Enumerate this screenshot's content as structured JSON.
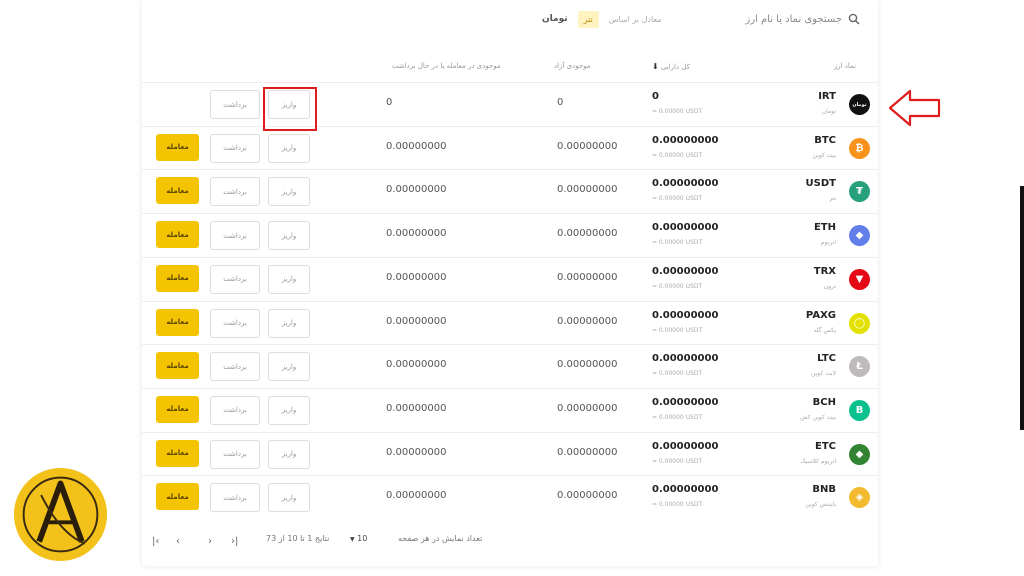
{
  "search": {
    "placeholder": "جستجوی نماد یا نام ارز"
  },
  "toggle": {
    "hint": "معادل بر اساس",
    "active": "تتر",
    "other": "تومان"
  },
  "table": {
    "headers": {
      "asset": "نماد ارز",
      "total": "کل دارایی",
      "available": "موجودی آزاد",
      "in_order": "موجودی در معامله یا در حال برداشت"
    },
    "rows": [
      {
        "symbol": "IRT",
        "name": "تومان",
        "balance": "0",
        "usdt": "≈ 0.00000 USDT",
        "available": "0",
        "in_order": "0",
        "icon": "toman-icon",
        "color": "#111111",
        "glyph": "تومان",
        "trade": false
      },
      {
        "symbol": "BTC",
        "name": "بیت کوین",
        "balance": "0.00000000",
        "usdt": "≈ 0.00000 USDT",
        "available": "0.00000000",
        "in_order": "0.00000000",
        "icon": "bitcoin-icon",
        "color": "#f7931a",
        "glyph": "₿",
        "trade": true
      },
      {
        "symbol": "USDT",
        "name": "تتر",
        "balance": "0.00000000",
        "usdt": "≈ 0.00000 USDT",
        "available": "0.00000000",
        "in_order": "0.00000000",
        "icon": "tether-icon",
        "color": "#26a17b",
        "glyph": "₮",
        "trade": true
      },
      {
        "symbol": "ETH",
        "name": "اتریوم",
        "balance": "0.00000000",
        "usdt": "≈ 0.00000 USDT",
        "available": "0.00000000",
        "in_order": "0.00000000",
        "icon": "ethereum-icon",
        "color": "#627eea",
        "glyph": "◆",
        "trade": true
      },
      {
        "symbol": "TRX",
        "name": "ترون",
        "balance": "0.00000000",
        "usdt": "≈ 0.00000 USDT",
        "available": "0.00000000",
        "in_order": "0.00000000",
        "icon": "tron-icon",
        "color": "#e50915",
        "glyph": "▼",
        "trade": true
      },
      {
        "symbol": "PAXG",
        "name": "پکس گلد",
        "balance": "0.00000000",
        "usdt": "≈ 0.00000 USDT",
        "available": "0.00000000",
        "in_order": "0.00000000",
        "icon": "paxgold-icon",
        "color": "#e4e100",
        "glyph": "◯",
        "trade": true
      },
      {
        "symbol": "LTC",
        "name": "لایت کوین",
        "balance": "0.00000000",
        "usdt": "≈ 0.00000 USDT",
        "available": "0.00000000",
        "in_order": "0.00000000",
        "icon": "litecoin-icon",
        "color": "#bfbbbb",
        "glyph": "Ł",
        "trade": true
      },
      {
        "symbol": "BCH",
        "name": "بیت کوین کش",
        "balance": "0.00000000",
        "usdt": "≈ 0.00000 USDT",
        "available": "0.00000000",
        "in_order": "0.00000000",
        "icon": "bitcoincash-icon",
        "color": "#0ac18e",
        "glyph": "B",
        "trade": true
      },
      {
        "symbol": "ETC",
        "name": "اتریوم کلاسیک",
        "balance": "0.00000000",
        "usdt": "≈ 0.00000 USDT",
        "available": "0.00000000",
        "in_order": "0.00000000",
        "icon": "ethereum-classic-icon",
        "color": "#328332",
        "glyph": "◆",
        "trade": true
      },
      {
        "symbol": "BNB",
        "name": "بایننس کوین",
        "balance": "0.00000000",
        "usdt": "≈ 0.00000 USDT",
        "available": "0.00000000",
        "in_order": "0.00000000",
        "icon": "binance-icon",
        "color": "#f3ba2f",
        "glyph": "◈",
        "trade": true
      }
    ],
    "deposit_label": "واریز",
    "withdraw_label": "برداشت",
    "trade_label": "معامله"
  },
  "footer": {
    "per_page_label": "تعداد نمایش در هر صفحه",
    "per_page_value": "10",
    "range": "نتایج 1 تا 10 از 73"
  },
  "pagination": {
    "first": "|‹",
    "prev": "‹",
    "next": "›",
    "last": "›|"
  }
}
